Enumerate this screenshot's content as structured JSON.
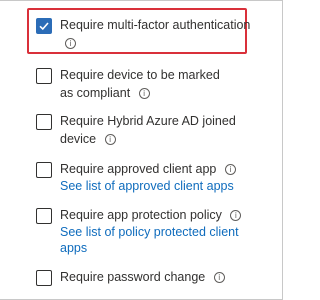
{
  "controls": [
    {
      "label": "Require multi-factor authentication",
      "checked": true,
      "link": ""
    },
    {
      "label": "Require device to be marked as compliant",
      "checked": false,
      "link": ""
    },
    {
      "label": "Require Hybrid Azure AD joined device",
      "checked": false,
      "link": ""
    },
    {
      "label": "Require approved client app",
      "checked": false,
      "link": "See list of approved client apps"
    },
    {
      "label": "Require app protection policy",
      "checked": false,
      "link": "See list of policy protected client apps"
    },
    {
      "label": "Require password change",
      "checked": false,
      "link": ""
    }
  ],
  "colors": {
    "accent": "#2b6cb7",
    "link": "#0f6cbd",
    "highlight_border": "#d9303a"
  },
  "icons": {
    "info": "info-circle-icon",
    "check": "checkmark-icon"
  }
}
